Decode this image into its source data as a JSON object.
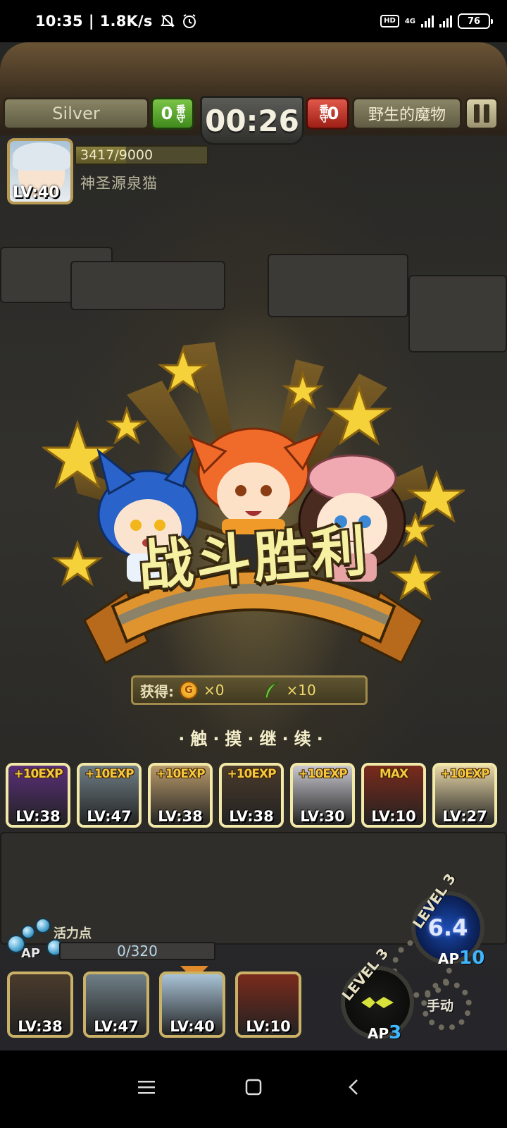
{
  "status_bar": {
    "time": "10:35",
    "network_speed": "1.8K/s",
    "hd_badge": "HD",
    "network_type": "4G",
    "battery_level": "76",
    "icons": [
      "notification-off-icon",
      "alarm-icon",
      "signal-icon",
      "battery-icon"
    ]
  },
  "hud": {
    "player_name": "Silver",
    "player_score": "0",
    "player_score_suffix": "番守",
    "timer": "00:26",
    "enemy_score": "0",
    "enemy_score_suffix": "番守",
    "enemy_label": "野生的魔物",
    "pause_icon": "pause-icon"
  },
  "enemy": {
    "hp_text": "3417/9000",
    "hp_fraction": 0.38,
    "name": "神圣源泉猫",
    "level": "LV:40"
  },
  "victory": {
    "title": "战斗胜利",
    "reward_label": "获得:",
    "coin_symbol": "G",
    "coin_amount": "×0",
    "feather_amount": "×10",
    "tap_to_continue": "·触·摸·继·续·"
  },
  "party_exp": [
    {
      "gain": "+10EXP",
      "level": "LV:38",
      "color": "#5a2f7a"
    },
    {
      "gain": "+10EXP",
      "level": "LV:47",
      "color": "#6f7f86"
    },
    {
      "gain": "+10EXP",
      "level": "LV:38",
      "color": "#b89a6a"
    },
    {
      "gain": "+10EXP",
      "level": "LV:38",
      "color": "#4b3b2c"
    },
    {
      "gain": "+10EXP",
      "level": "LV:30",
      "color": "#c9c9cf"
    },
    {
      "gain": "MAX",
      "level": "LV:10",
      "color": "#7a2a1c"
    },
    {
      "gain": "+10EXP",
      "level": "LV:27",
      "color": "#e9d8a8"
    }
  ],
  "ap": {
    "label": "活力点",
    "tag": "AP",
    "value": "0/320",
    "fraction": 0
  },
  "team": [
    {
      "level": "LV:38",
      "color": "#4b3b2c"
    },
    {
      "level": "LV:47",
      "color": "#6f7f86"
    },
    {
      "level": "LV:40",
      "color": "#a9c3d6"
    },
    {
      "level": "LV:10",
      "color": "#7a2a1c"
    }
  ],
  "skills": {
    "big": {
      "level_text": "LEVEL 3",
      "cooldown": "6.4",
      "ap_prefix": "AP",
      "ap_cost": "10"
    },
    "dark": {
      "level_text": "LEVEL 3",
      "ap_prefix": "AP",
      "ap_cost": "3"
    },
    "manual_label": "手动"
  },
  "navbar": {
    "icons": [
      "menu-icon",
      "home-icon",
      "back-icon"
    ]
  },
  "colors": {
    "gold": "#f6f1a2",
    "ribbon_orange": "#e0942f",
    "hud_green": "#4fa028",
    "hud_red": "#c0392b",
    "ap_blue": "#3fb7ff"
  }
}
